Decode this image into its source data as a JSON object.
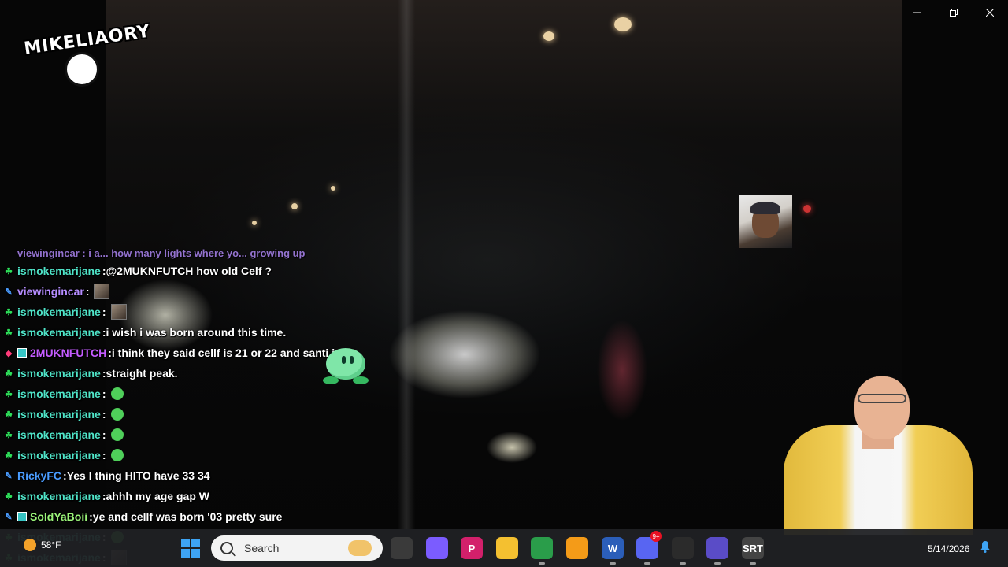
{
  "window": {
    "minimize_icon": "minimize-icon",
    "restore_icon": "restore-icon",
    "close_icon": "close-icon"
  },
  "overlay": {
    "logo_text": "MIKELIAORY"
  },
  "chat": {
    "partial_top": "viewingincar : i a... how many lights where yo... growing up",
    "messages": [
      {
        "user": "ismokemarijane",
        "badge": "leaf",
        "color": "#4fe4c8",
        "text": "@2MUKNFUTCH how old Celf ?",
        "emote": null
      },
      {
        "user": "viewingincar",
        "badge": "pen",
        "color": "#b58cff",
        "text": "",
        "emote": "image"
      },
      {
        "user": "ismokemarijane",
        "badge": "leaf",
        "color": "#4fe4c8",
        "text": "",
        "emote": "image"
      },
      {
        "user": "ismokemarijane",
        "badge": "leaf",
        "color": "#4fe4c8",
        "text": "i wish i was born around this time.",
        "emote": null
      },
      {
        "user": "2MUKNFUTCH",
        "badge": "gift",
        "color": "#c45cff",
        "text": "i think they said cellf is 21 or 22 and santi is 22",
        "emote": null
      },
      {
        "user": "ismokemarijane",
        "badge": "leaf",
        "color": "#4fe4c8",
        "text": "straight peak.",
        "emote": null
      },
      {
        "user": "ismokemarijane",
        "badge": "leaf",
        "color": "#4fe4c8",
        "text": "",
        "emote": "green"
      },
      {
        "user": "ismokemarijane",
        "badge": "leaf",
        "color": "#4fe4c8",
        "text": "",
        "emote": "green"
      },
      {
        "user": "ismokemarijane",
        "badge": "leaf",
        "color": "#4fe4c8",
        "text": "",
        "emote": "green"
      },
      {
        "user": "ismokemarijane",
        "badge": "leaf",
        "color": "#4fe4c8",
        "text": "",
        "emote": "green"
      },
      {
        "user": "RickyFC",
        "badge": "pen",
        "color": "#4a9cff",
        "text": "Yes I thing HITO have 33 34",
        "emote": null
      },
      {
        "user": "ismokemarijane",
        "badge": "leaf",
        "color": "#4fe4c8",
        "text": "ahhh my age gap W",
        "emote": null
      },
      {
        "user": "SoldYaBoii",
        "badge": "pen",
        "color": "#9bf57a",
        "text": "ye and cellf was born '03 pretty sure",
        "emote": null
      },
      {
        "user": "ismokemarijane",
        "badge": "leaf",
        "color": "#4fe4c8",
        "text": "",
        "emote": "green"
      },
      {
        "user": "ismokemarijane",
        "badge": "leaf",
        "color": "#4fe4c8",
        "text": "",
        "emote": "image"
      }
    ]
  },
  "taskbar": {
    "weather_temp": "58°F",
    "search_placeholder": "Search",
    "apps": [
      {
        "name": "task-view",
        "label": "",
        "color": "#3a3a3a",
        "dot": false
      },
      {
        "name": "copilot",
        "label": "",
        "color": "#7b5cff",
        "dot": false
      },
      {
        "name": "picsart",
        "label": "P",
        "color": "#d3206b",
        "dot": false
      },
      {
        "name": "file-explorer",
        "label": "",
        "color": "#f4c030",
        "dot": false
      },
      {
        "name": "chrome",
        "label": "",
        "color": "#2a9d4a",
        "dot": true
      },
      {
        "name": "app-sun",
        "label": "",
        "color": "#f49b18",
        "dot": false
      },
      {
        "name": "word",
        "label": "W",
        "color": "#2b5eb9",
        "dot": true
      },
      {
        "name": "discord",
        "label": "",
        "color": "#5865f2",
        "dot": true,
        "badge": "9+"
      },
      {
        "name": "obs",
        "label": "",
        "color": "#2b2b2b",
        "dot": true
      },
      {
        "name": "app-diamond",
        "label": "",
        "color": "#5a4cc7",
        "dot": true
      },
      {
        "name": "app-srt",
        "label": "SRT",
        "color": "#444",
        "dot": true
      }
    ],
    "date": "5/14/2026"
  }
}
